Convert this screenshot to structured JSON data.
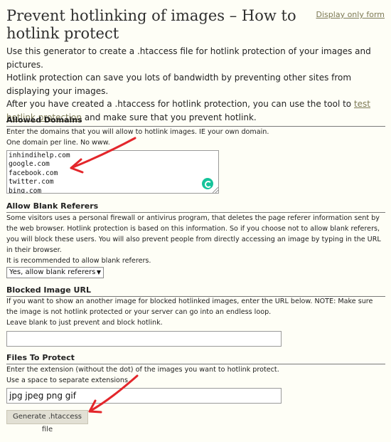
{
  "header": {
    "title_line1": "Prevent hotlinking of images – How to",
    "title_line2": "hotlink protect",
    "display_only_form": "Display only form"
  },
  "intro": {
    "line1": "Use this generator to create a .htaccess file for hotlink protection of your images and pictures.",
    "line2": "Hotlink protection can save you lots of bandwidth by preventing other sites from displaying your images.",
    "line3_before": "After you have created a .htaccess for hotlink protection, you can use the tool to ",
    "line3_link": "test hotlink protection",
    "line3_after": " and make sure that you prevent hotlink."
  },
  "allowed_domains": {
    "heading": "Allowed Domains",
    "desc1": "Enter the domains that you will allow to hotlink images. IE your own domain.",
    "desc2": "One domain per line. No www.",
    "values": [
      "inhindihelp.com",
      "google.com",
      "facebook.com",
      "twitter.com",
      "bing.com"
    ]
  },
  "blank_referers": {
    "heading": "Allow Blank Referers",
    "desc1": "Some visitors uses a personal firewall or antivirus program, that deletes the page referer information sent by the web browser. Hotlink protection is based on this information. So if you choose not to allow blank referers, you will block these users. You will also prevent people from directly accessing an image by typing in the URL in their browser.",
    "desc2": "It is recommended to allow blank referers.",
    "selected": "Yes, allow blank referers"
  },
  "blocked_url": {
    "heading": "Blocked Image URL",
    "desc1": "If you want to show an another image for blocked hotlinked images, enter the URL below. NOTE: Make sure the image is not hotlink protected or your server can go into an endless loop.",
    "desc2": "Leave blank to just prevent and block hotlink.",
    "value": ""
  },
  "files": {
    "heading": "Files To Protect",
    "desc1": "Enter the extension (without the dot) of the images you want to hotlink protect.",
    "desc2": "Use a space to separate extensions.",
    "value": "jpg jpeg png gif"
  },
  "actions": {
    "generate_label": "Generate .htaccess file"
  },
  "colors": {
    "background": "#fefef6",
    "link": "#7d7a55",
    "annotation_arrow": "#e3262b",
    "grammarly": "#15c39a"
  }
}
